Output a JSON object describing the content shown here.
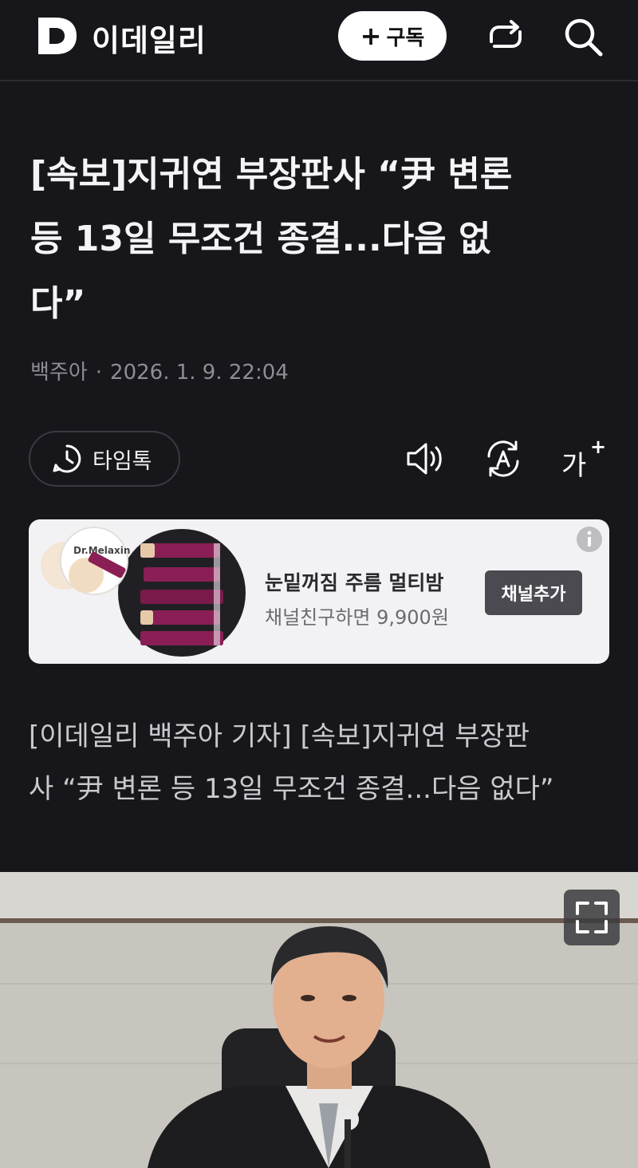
{
  "header": {
    "logo_letter": "D",
    "brand": "이데일리",
    "subscribe_plus": "+",
    "subscribe_label": "구독",
    "share_icon": "share-icon",
    "search_icon": "search-icon"
  },
  "article": {
    "headline_line1": "[속보]지귀연 부장판사 “尹 변론",
    "headline_line2": "등 13일 무조건 종결...다음 없",
    "headline_line3": "다”",
    "author": "백주아",
    "separator": "·",
    "datetime": "2026. 1. 9. 22:04",
    "lead_line1": "[이데일리 백주아 기자] [속보]지귀연 부장판",
    "lead_line2": "사 “尹 변론 등 13일 무조건 종결...다음 없다”"
  },
  "toolbar": {
    "timetalk_label": "타임톡",
    "font_size_label": "가",
    "font_size_plus": "+",
    "tts_icon": "speaker-icon",
    "translate_icon": "auto-translate-icon"
  },
  "ad": {
    "brand_text": "Dr.Melaxin",
    "title": "눈밑꺼짐 주름 멀티밤",
    "subtitle": "채널친구하면 9,900원",
    "button_label": "채널추가",
    "info_label": "i"
  },
  "colors": {
    "background": "#17171b",
    "text_primary": "#f4f4f6",
    "text_meta": "#8d8d93",
    "ad_background": "#f2f2f4",
    "ad_button": "#4a4a50",
    "product_magenta": "#8a1f55"
  }
}
